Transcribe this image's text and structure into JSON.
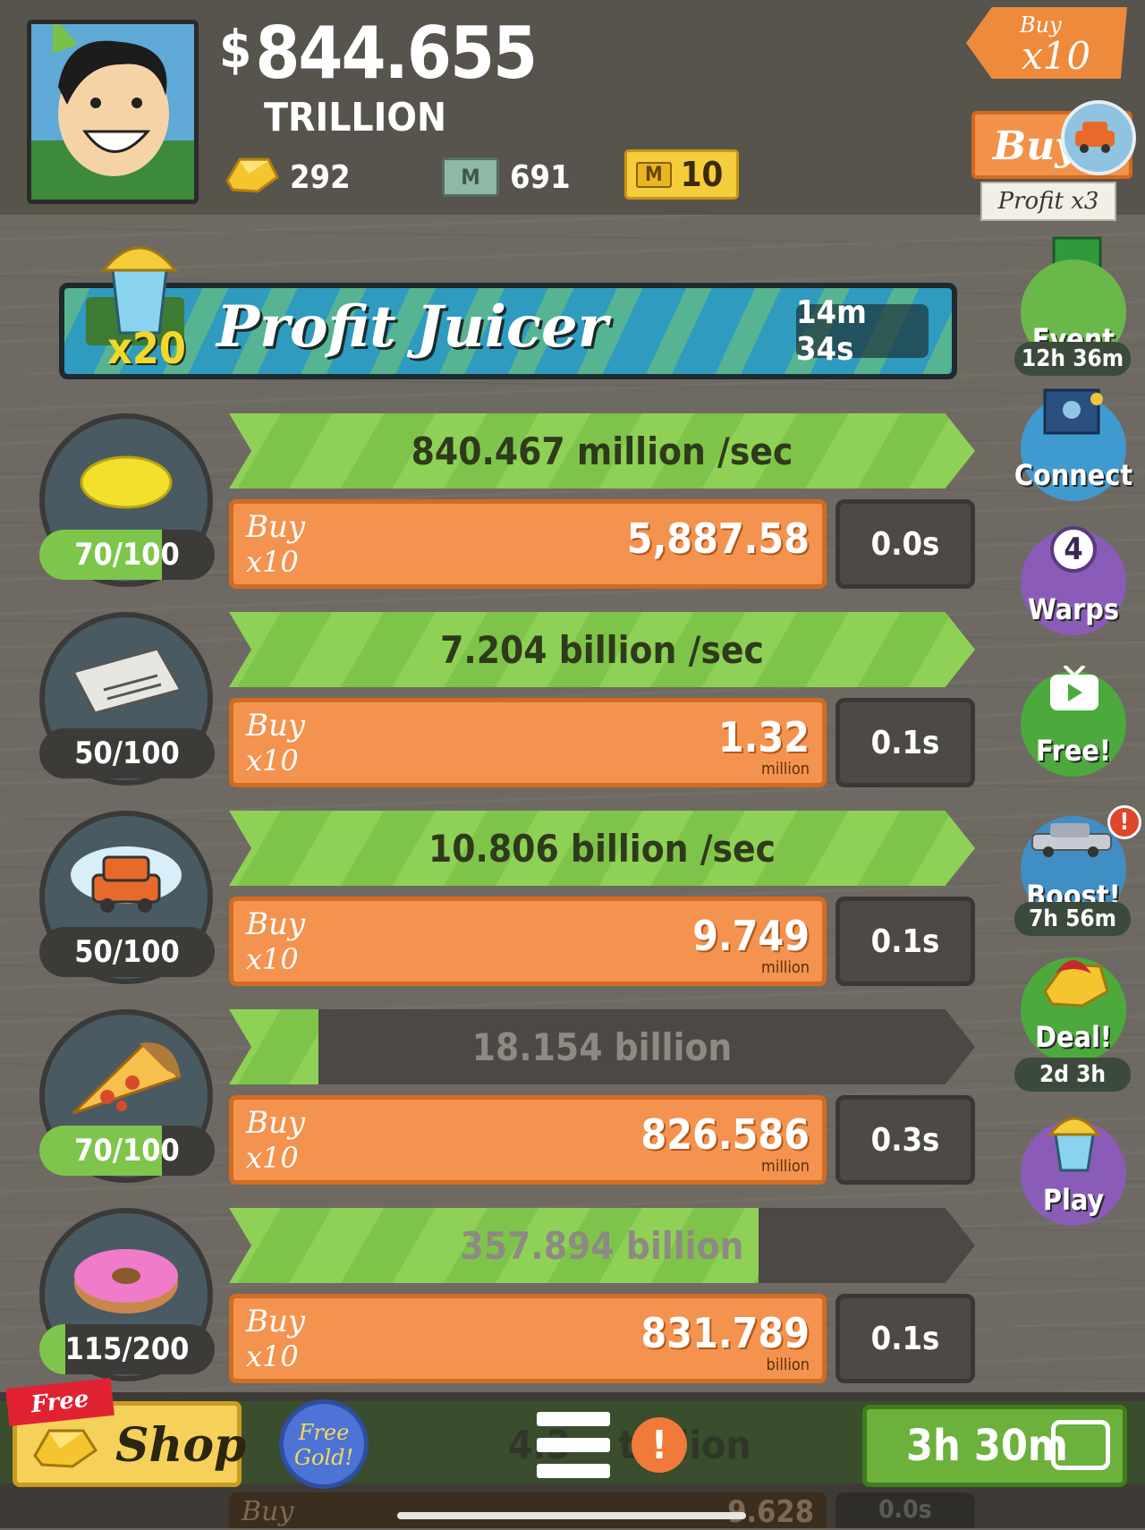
{
  "header": {
    "currency_symbol": "$",
    "money": "844.655",
    "money_unit": "TRILLION",
    "gold": "292",
    "megabucks_icon_label": "M",
    "megabucks": "691",
    "tickets_icon_label": "M",
    "tickets": "10",
    "buy_multiplier_small": "Buy",
    "buy_multiplier": "x10",
    "upgrade_buy_label": "Buy",
    "upgrade_profit": "Profit x3"
  },
  "juicer": {
    "multiplier": "x20",
    "title": "Profit Juicer",
    "timer": "14m 34s"
  },
  "businesses": [
    {
      "icon": "lemon-icon",
      "owned": "70/100",
      "owned_fraction": 0.7,
      "progress_text": "840.467 million /sec",
      "progress_fraction": 1.0,
      "buy_l1": "Buy",
      "buy_l2": "x10",
      "cost": "5,887.58",
      "cost_unit": "",
      "timer": "0.0s"
    },
    {
      "icon": "newspaper-icon",
      "owned": "50/100",
      "owned_fraction": 0.0,
      "progress_text": "7.204 billion /sec",
      "progress_fraction": 1.0,
      "buy_l1": "Buy",
      "buy_l2": "x10",
      "cost": "1.32",
      "cost_unit": "million",
      "timer": "0.1s"
    },
    {
      "icon": "car-wash-icon",
      "owned": "50/100",
      "owned_fraction": 0.0,
      "progress_text": "10.806 billion /sec",
      "progress_fraction": 1.0,
      "buy_l1": "Buy",
      "buy_l2": "x10",
      "cost": "9.749",
      "cost_unit": "million",
      "timer": "0.1s"
    },
    {
      "icon": "pizza-icon",
      "owned": "70/100",
      "owned_fraction": 0.7,
      "progress_text": "18.154 billion",
      "progress_fraction": 0.12,
      "buy_l1": "Buy",
      "buy_l2": "x10",
      "cost": "826.586",
      "cost_unit": "million",
      "timer": "0.3s"
    },
    {
      "icon": "donut-icon",
      "owned": "115/200",
      "owned_fraction": 0.15,
      "progress_text": "357.894 billion",
      "progress_fraction": 0.71,
      "buy_l1": "Buy",
      "buy_l2": "x10",
      "cost": "831.789",
      "cost_unit": "billion",
      "timer": "0.1s"
    }
  ],
  "side_buttons": {
    "event": "Event",
    "event_timer": "12h 36m",
    "connect": "Connect",
    "warps_count": "4",
    "warps": "Warps",
    "free": "Free!",
    "boost": "Boost!",
    "boost_alert": "!",
    "boost_timer": "7h 56m",
    "deal": "Deal!",
    "deal_timer": "2d 3h",
    "play": "Play"
  },
  "bottom": {
    "free_ribbon": "Free",
    "shop": "Shop",
    "free_gold": "Free Gold!",
    "ghost_total": "4.3__ trillion",
    "alert": "!",
    "ad_timer": "3h 30m",
    "next_row_buy": "Buy",
    "next_row_cost": "9.628",
    "next_row_timer": "0.0s"
  },
  "colors": {
    "progress_green": "#8fd156",
    "buy_orange": "#f4934f",
    "background": "#6e6a63",
    "gold_yellow": "#f5d15a"
  }
}
